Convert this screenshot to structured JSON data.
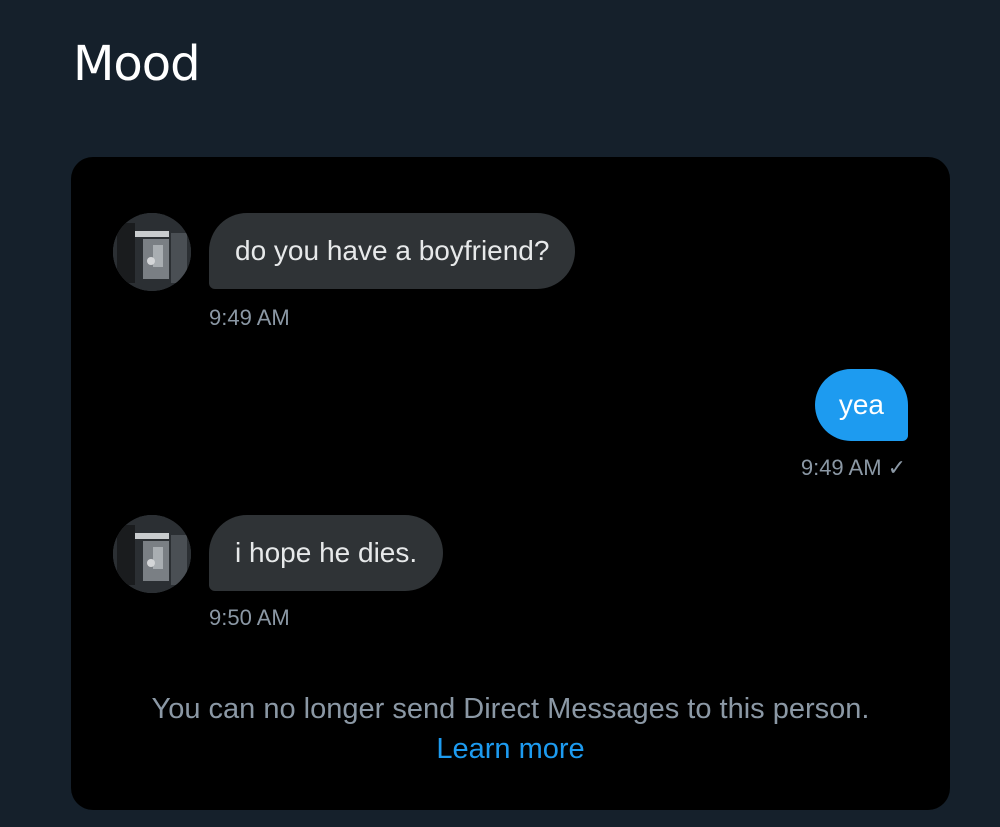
{
  "post": {
    "text": "Mood"
  },
  "conversation": {
    "messages": [
      {
        "direction": "incoming",
        "text": "do you have a boyfriend?",
        "time": "9:49 AM"
      },
      {
        "direction": "outgoing",
        "text": "yea",
        "time": "9:49 AM",
        "status_icon": "check-icon",
        "status_glyph": "✓"
      },
      {
        "direction": "incoming",
        "text": "i hope he dies.",
        "time": "9:50 AM"
      }
    ],
    "notice": {
      "text": "You can no longer send Direct Messages to this person.",
      "link_label": "Learn more"
    }
  },
  "colors": {
    "background": "#15202b",
    "card": "#000000",
    "incoming_bubble": "#2f3336",
    "outgoing_bubble": "#1d9bf0",
    "link": "#1d9bf0",
    "muted_text": "#8b98a5"
  }
}
